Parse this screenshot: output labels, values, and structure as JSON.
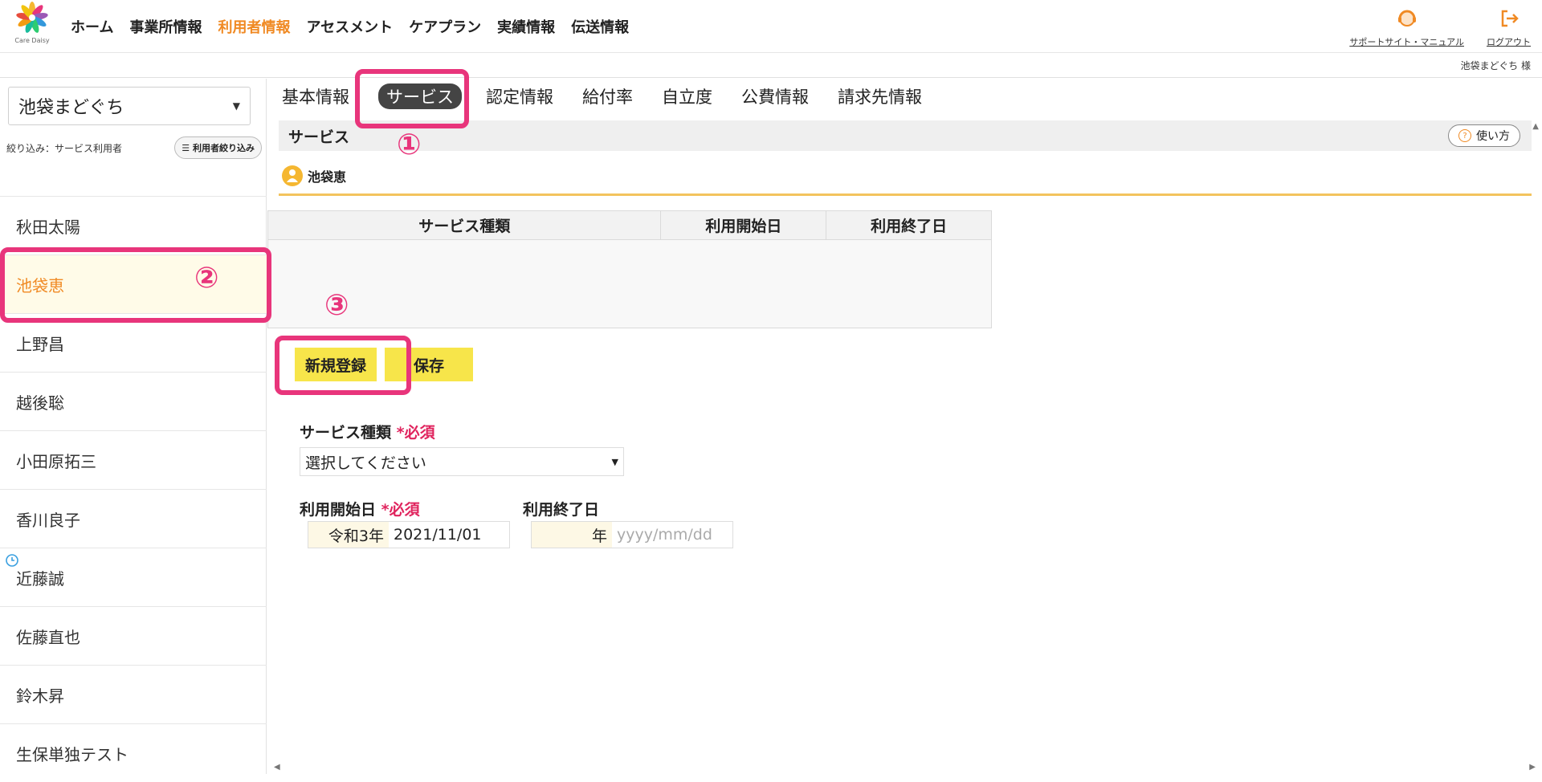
{
  "app": {
    "logo_text": "Care Daisy",
    "nav": [
      {
        "label": "ホーム",
        "active": false
      },
      {
        "label": "事業所情報",
        "active": false
      },
      {
        "label": "利用者情報",
        "active": true
      },
      {
        "label": "アセスメント",
        "active": false
      },
      {
        "label": "ケアプラン",
        "active": false
      },
      {
        "label": "実績情報",
        "active": false
      },
      {
        "label": "伝送情報",
        "active": false
      }
    ],
    "support_label": "サポートサイト・マニュアル",
    "logout_label": "ログアウト",
    "current_user": "池袋まどぐち 様",
    "accent_color": "#f08a24"
  },
  "sidebar": {
    "office_value": "池袋まどぐち",
    "filter_label": "絞り込み：サービス利用者",
    "filter_button": "利用者絞り込み",
    "users": [
      {
        "name": "秋田太陽"
      },
      {
        "name": "池袋恵",
        "selected": true
      },
      {
        "name": "上野昌"
      },
      {
        "name": "越後聡"
      },
      {
        "name": "小田原拓三"
      },
      {
        "name": "香川良子"
      },
      {
        "name": "近藤誠",
        "icon": "clock-icon"
      },
      {
        "name": "佐藤直也"
      },
      {
        "name": "鈴木昇"
      },
      {
        "name": "生保単独テスト"
      }
    ]
  },
  "main": {
    "tabs": [
      {
        "label": "基本情報"
      },
      {
        "label": "サービス",
        "active": true
      },
      {
        "label": "認定情報"
      },
      {
        "label": "給付率"
      },
      {
        "label": "自立度"
      },
      {
        "label": "公費情報"
      },
      {
        "label": "請求先情報"
      }
    ],
    "section_title": "サービス",
    "howto_label": "使い方",
    "person_name": "池袋恵",
    "table_headers": [
      "サービス種類",
      "利用開始日",
      "利用終了日"
    ],
    "buttons": {
      "new": "新規登録",
      "save": "保存"
    },
    "form": {
      "service_type_label": "サービス種類",
      "required_mark": "*必須",
      "service_type_value": "選択してください",
      "start_label": "利用開始日",
      "end_label": "利用終了日",
      "start_era": "令和3年",
      "start_value": "2021/11/01",
      "end_era": "年",
      "end_placeholder": "yyyy/mm/dd"
    }
  },
  "annotations": [
    "①",
    "②",
    "③"
  ]
}
